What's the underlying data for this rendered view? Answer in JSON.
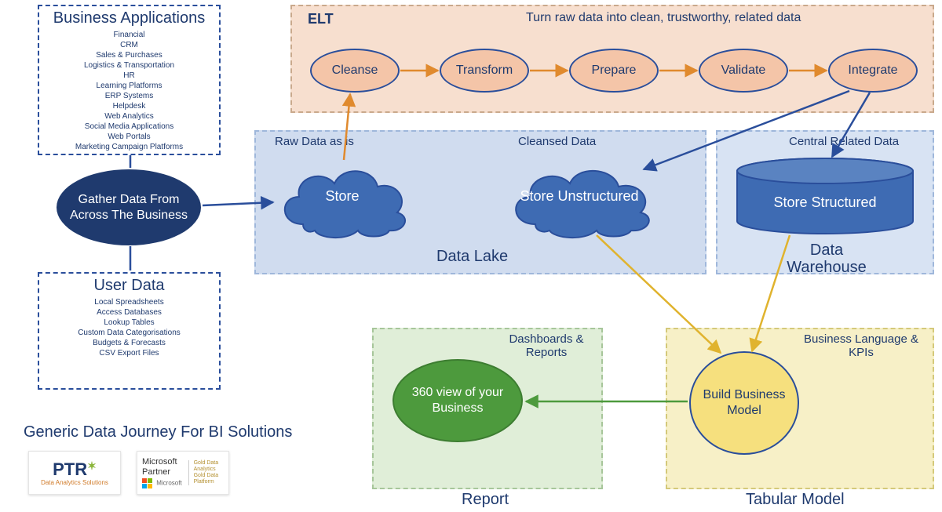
{
  "businessApps": {
    "title": "Business Applications",
    "items": [
      "Financial",
      "CRM",
      "Sales & Purchases",
      "Logistics & Transportation",
      "HR",
      "Learning Platforms",
      "ERP Systems",
      "Helpdesk",
      "Web Analytics",
      "Social Media Applications",
      "Web Portals",
      "Marketing Campaign Platforms"
    ]
  },
  "userData": {
    "title": "User Data",
    "items": [
      "Local Spreadsheets",
      "Access Databases",
      "Lookup Tables",
      "Custom Data Categorisations",
      "Budgets & Forecasts",
      "CSV Export Files"
    ]
  },
  "gather": "Gather Data From Across The Business",
  "elt": {
    "label": "ELT",
    "subtitle": "Turn raw data into clean, trustworthy, related data",
    "steps": [
      "Cleanse",
      "Transform",
      "Prepare",
      "Validate",
      "Integrate"
    ]
  },
  "dataLake": {
    "label": "Data Lake",
    "rawLabel": "Raw Data as is",
    "cleansedLabel": "Cleansed Data",
    "storeRaw": "Store",
    "storeUnstructured": "Store Unstructured"
  },
  "warehouse": {
    "label": "Data Warehouse",
    "topLabel": "Central Related Data",
    "store": "Store Structured"
  },
  "tabular": {
    "label": "Tabular Model",
    "caption": "Business Language & KPIs",
    "node": "Build Business Model"
  },
  "report": {
    "label": "Report",
    "caption": "Dashboards & Reports",
    "node": "360 view of your Business"
  },
  "footerTitle": "Generic Data Journey For BI Solutions",
  "logos": {
    "ptr": "PTR",
    "ptrSub": "Data Analytics Solutions",
    "msPartner": "Microsoft Partner",
    "msSub": "Microsoft",
    "gold1": "Gold Data Analytics",
    "gold2": "Gold Data Platform"
  }
}
